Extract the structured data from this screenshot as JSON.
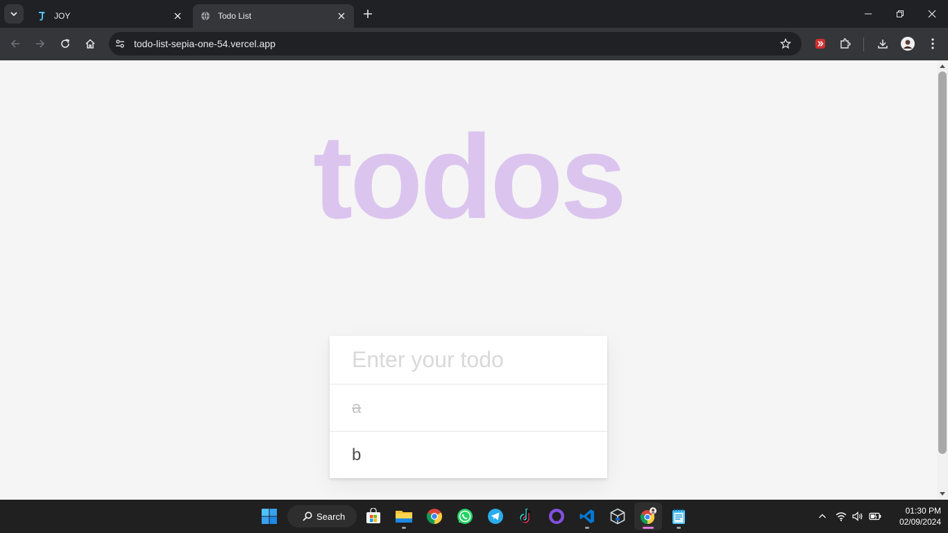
{
  "browser": {
    "tabs": [
      {
        "title": "JOY",
        "active": false
      },
      {
        "title": "Todo List",
        "active": true
      }
    ],
    "address": "todo-list-sepia-one-54.vercel.app"
  },
  "page": {
    "app_title": "todos",
    "input_placeholder": "Enter your todo",
    "input_value": "",
    "todos": [
      {
        "text": "a",
        "completed": true
      },
      {
        "text": "b",
        "completed": false
      }
    ]
  },
  "taskbar": {
    "search_label": "Search",
    "apps": [
      "start-icon",
      "microsoft-store-icon",
      "file-explorer-icon",
      "chrome-icon",
      "whatsapp-icon",
      "telegram-icon",
      "tiktok-icon",
      "github-desktop-icon",
      "vscode-icon",
      "virtualbox-icon",
      "chrome-profile-icon",
      "notepad-icon"
    ],
    "time": "01:30 PM",
    "date": "02/09/2024"
  },
  "colors": {
    "title": "#dbc5ef",
    "page_bg": "#f5f5f5",
    "browser_dark": "#202124",
    "toolbar": "#35363a"
  }
}
